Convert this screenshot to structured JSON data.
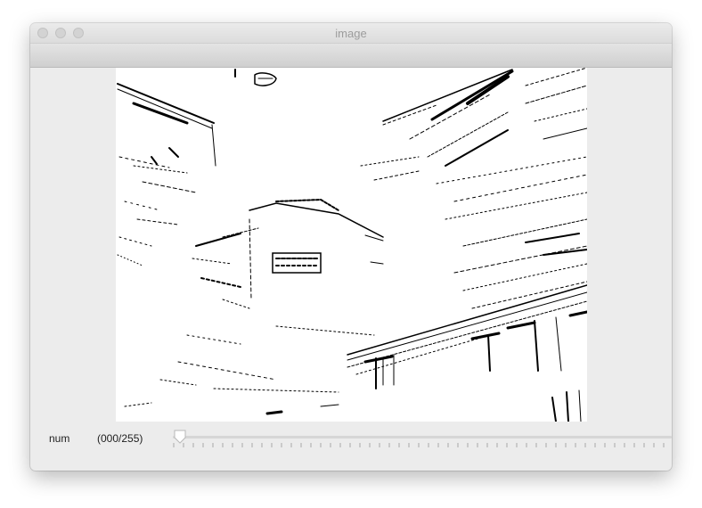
{
  "window": {
    "title": "image"
  },
  "trackbar": {
    "label": "num",
    "value_text": "(000/255)",
    "value": 0,
    "max": 255
  },
  "canvas": {
    "description_icon": "binary-threshold-image"
  },
  "colors": {
    "window_bg": "#ececec",
    "title_text": "#9c9c9c",
    "ink": "#000000"
  }
}
